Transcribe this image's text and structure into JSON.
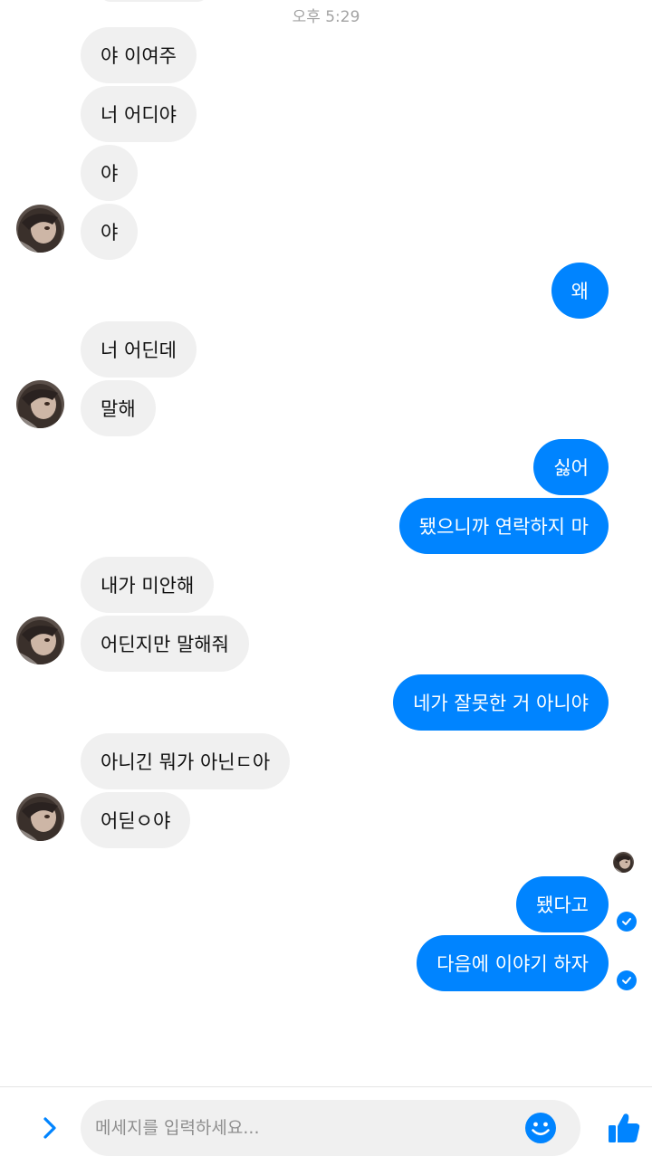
{
  "header": {
    "timestamp": "오후 5:29"
  },
  "colors": {
    "outgoing": "#0084ff",
    "incoming": "#f0f0f0",
    "accent": "#0084ff"
  },
  "messages": [
    {
      "from": "them",
      "text": "야 이여주"
    },
    {
      "from": "them",
      "text": "너 어디야"
    },
    {
      "from": "them",
      "text": "야"
    },
    {
      "from": "them",
      "text": "야"
    },
    {
      "from": "me",
      "text": "왜"
    },
    {
      "from": "them",
      "text": "너 어딘데"
    },
    {
      "from": "them",
      "text": "말해"
    },
    {
      "from": "me",
      "text": "싫어"
    },
    {
      "from": "me",
      "text": "됐으니까 연락하지 마"
    },
    {
      "from": "them",
      "text": "내가 미안해"
    },
    {
      "from": "them",
      "text": "어딘지만 말해줘"
    },
    {
      "from": "me",
      "text": "네가 잘못한 거 아니야"
    },
    {
      "from": "them",
      "text": "아니긴 뭐가 아닌ㄷ아"
    },
    {
      "from": "them",
      "text": "어딛ㅇ야"
    },
    {
      "from": "me",
      "text": "됐다고"
    },
    {
      "from": "me",
      "text": "다음에 이야기 하자"
    }
  ],
  "composer": {
    "placeholder": "메세지를 입력하세요...",
    "icons": {
      "expand": "chevron-right-icon",
      "emoji": "smiley-icon",
      "like": "thumbs-up-icon"
    }
  }
}
